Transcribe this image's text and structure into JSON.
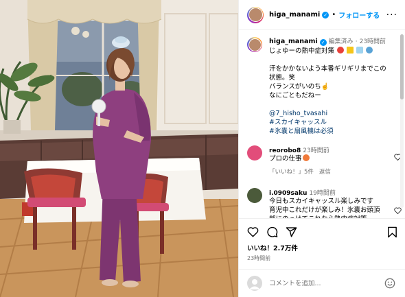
{
  "post": {
    "username": "higa_manami",
    "follow_label": "フォローする",
    "more_label": "···",
    "caption": {
      "edited": "編集済み",
      "time": "23時間前",
      "title": "じょゆーの熱中症対策",
      "text": "汗をかかないよう本番ギリギリまでこの状態。笑\nバランスがいのち☝️\nなにごともだねー",
      "tags": [
        "@7_hisho_tvasahi",
        "#スカイキャッスル",
        "#氷嚢と扇風機は必須"
      ]
    },
    "comments": [
      {
        "username": "reorobo8",
        "time": "23時間前",
        "text": "プロの仕事",
        "likes_label": "「いいね！」5件",
        "reply_label": "返信"
      },
      {
        "username": "i.0909saku",
        "time": "19時間前",
        "text": "今日もスカイキャッスル楽しみです　育児中これだけが楽しみ！氷嚢お頭頂部にのっけてこれなら熱中症対策"
      }
    ],
    "likes": "いいね！2.7万件",
    "posted": "23時間前",
    "comment_placeholder": "コメントを追加..."
  },
  "colors": {
    "accent": "#0095f6",
    "dress": "#8e3f7f",
    "wall": "#e9e1d6",
    "chair": "#b23a2f",
    "tablecloth": "#f7f4ef",
    "sofa": "#5a3c35"
  },
  "icons": [
    "heart-icon",
    "comment-icon",
    "share-icon",
    "bookmark-icon",
    "more-icon",
    "smile-icon",
    "verified-badge"
  ]
}
